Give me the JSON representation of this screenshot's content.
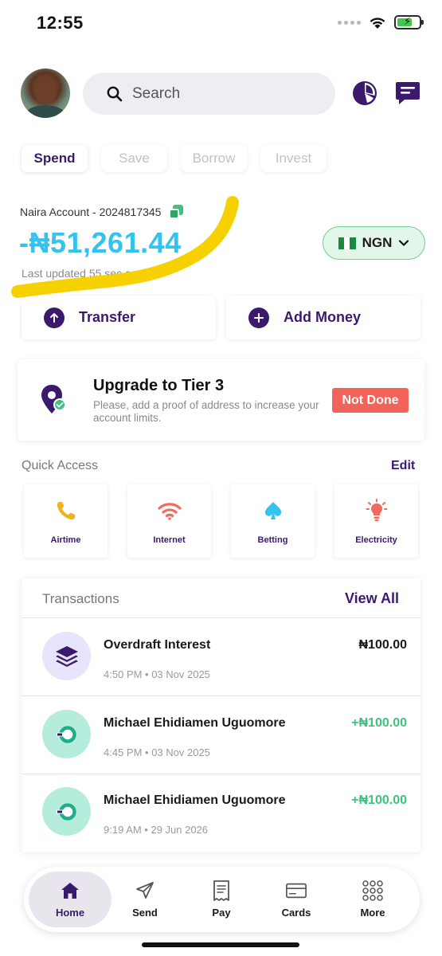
{
  "status_bar": {
    "time": "12:55"
  },
  "header": {
    "search_placeholder": "Search"
  },
  "tabs": [
    {
      "label": "Spend",
      "active": true
    },
    {
      "label": "Save",
      "active": false
    },
    {
      "label": "Borrow",
      "active": false
    },
    {
      "label": "Invest",
      "active": false
    }
  ],
  "account": {
    "label": "Naira Account - 2024817345",
    "balance": "-₦51,261.44",
    "last_updated": "Last updated 55 sec ago.",
    "currency": "NGN"
  },
  "actions": {
    "transfer": "Transfer",
    "add_money": "Add Money"
  },
  "upgrade": {
    "title": "Upgrade to Tier 3",
    "description": "Please, add a proof of address to increase your account limits.",
    "status": "Not Done"
  },
  "quick_access": {
    "title": "Quick Access",
    "edit": "Edit",
    "items": [
      {
        "label": "Airtime",
        "icon": "phone-icon",
        "color": "#f2b21e"
      },
      {
        "label": "Internet",
        "icon": "wifi-icon",
        "color": "#f06b5e"
      },
      {
        "label": "Betting",
        "icon": "spade-icon",
        "color": "#33c3ee"
      },
      {
        "label": "Electricity",
        "icon": "bulb-icon",
        "color": "#f06b5e"
      }
    ]
  },
  "transactions": {
    "title": "Transactions",
    "view_all": "View All",
    "items": [
      {
        "name": "Overdraft Interest",
        "time": "4:50 PM • 03 Nov 2025",
        "amount": "₦100.00",
        "icon": "layers-icon"
      },
      {
        "name": "Michael Ehidiamen Uguomore",
        "time": "4:45 PM • 03 Nov 2025",
        "amount": "+₦100.00",
        "icon": "transfer-in-icon"
      },
      {
        "name": "Michael Ehidiamen Uguomore",
        "time": "9:19 AM • 29 Jun 2026",
        "amount": "+₦100.00",
        "icon": "transfer-in-icon"
      }
    ]
  },
  "bottom_nav": [
    {
      "label": "Home",
      "active": true
    },
    {
      "label": "Send",
      "active": false
    },
    {
      "label": "Pay",
      "active": false
    },
    {
      "label": "Cards",
      "active": false
    },
    {
      "label": "More",
      "active": false
    }
  ],
  "colors": {
    "brand_purple": "#3b1a6e",
    "balance_blue": "#33c3ee",
    "credit_green": "#3fc27d",
    "alert_red": "#f2645a",
    "highlight_yellow": "#f7d000"
  }
}
